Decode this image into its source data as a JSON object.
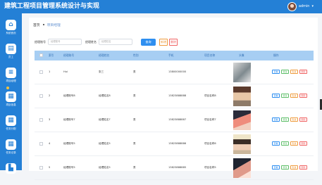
{
  "header": {
    "title": "建筑工程项目管理系统设计与实现",
    "user": "admin",
    "caret": "▾"
  },
  "sidebar": {
    "items": [
      {
        "icon": "home-icon",
        "glyph": "⌂",
        "label": "系统首页"
      },
      {
        "icon": "document-icon",
        "glyph": "▤",
        "label": "员工"
      },
      {
        "icon": "list-icon",
        "glyph": "≡",
        "label": "项目经理"
      },
      {
        "icon": "grid-icon",
        "glyph": "▦",
        "label": "项目信息"
      },
      {
        "icon": "grid-icon",
        "glyph": "▦",
        "label": "任务分配"
      },
      {
        "icon": "grid-icon",
        "glyph": "▦",
        "label": "任务记录"
      },
      {
        "icon": "folder-icon",
        "glyph": "▙",
        "label": ""
      }
    ]
  },
  "breadcrumb": {
    "home": "首页",
    "current": "项目经理"
  },
  "search": {
    "field1_label": "经理账号",
    "field1_placeholder": "经理账号",
    "field2_label": "经理姓名",
    "field2_placeholder": "经理姓名",
    "search_button": "查询",
    "add_button": "新增",
    "delete_button": "删除"
  },
  "table": {
    "headers": [
      "索引",
      "经理账号",
      "经理姓名",
      "性别",
      "手机",
      "项目名称",
      "头像",
      "操作"
    ],
    "actions": [
      "查看",
      "修改",
      "私信",
      "删除"
    ],
    "rows": [
      {
        "index": "1",
        "account": "Hui",
        "name": "张三",
        "gender": "男",
        "phone": "13800000000",
        "project": "",
        "photo": "p1"
      },
      {
        "index": "2",
        "account": "经理账号8",
        "name": "经理姓名8",
        "gender": "男",
        "phone": "13823888888",
        "project": "项目名称8",
        "photo": "p2"
      },
      {
        "index": "3",
        "account": "经理账号7",
        "name": "经理姓名7",
        "gender": "男",
        "phone": "13823888887",
        "project": "项目名称7",
        "photo": "p3"
      },
      {
        "index": "4",
        "account": "经理账号5",
        "name": "经理姓名5",
        "gender": "男",
        "phone": "13823888886",
        "project": "项目名称6",
        "photo": "p4"
      },
      {
        "index": "5",
        "account": "经理账号5",
        "name": "经理姓名5",
        "gender": "男",
        "phone": "13823888885",
        "project": "项目名称5",
        "photo": "p5"
      }
    ]
  },
  "colors": {
    "primary": "#2480d6",
    "accent": "#f5c23b",
    "table_header": "#a7cef3"
  }
}
